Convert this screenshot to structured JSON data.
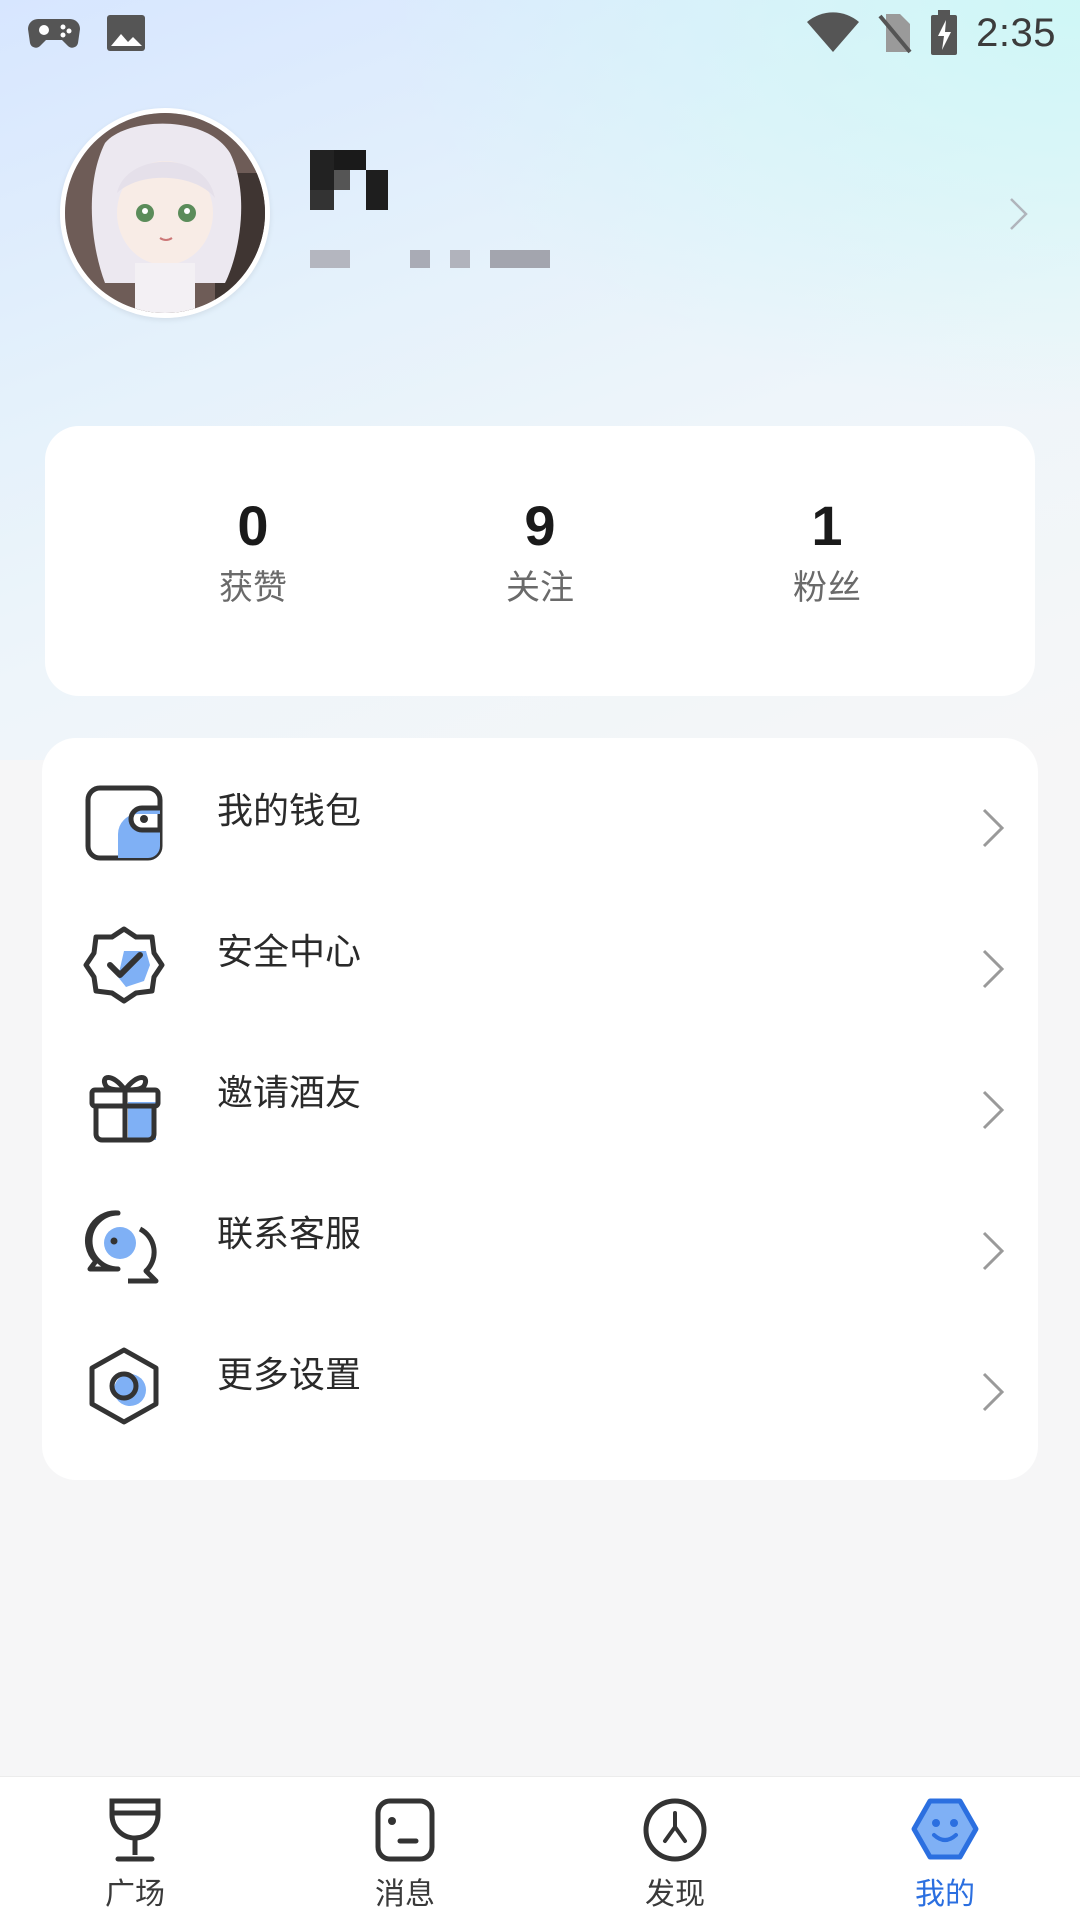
{
  "status_bar": {
    "time": "2:35",
    "left_icons": [
      "gamepad-icon",
      "image-icon"
    ],
    "right_icons": [
      "wifi-icon",
      "no-sim-icon",
      "battery-charging-icon"
    ]
  },
  "profile": {
    "name": "",
    "id_text": "",
    "avatar_icon": "avatar-image"
  },
  "stats": [
    {
      "value": "0",
      "label": "获赞"
    },
    {
      "value": "9",
      "label": "关注"
    },
    {
      "value": "1",
      "label": "粉丝"
    }
  ],
  "menu": [
    {
      "label": "我的钱包",
      "icon": "wallet-icon"
    },
    {
      "label": "安全中心",
      "icon": "security-badge-icon"
    },
    {
      "label": "邀请酒友",
      "icon": "gift-icon"
    },
    {
      "label": "联系客服",
      "icon": "chat-bubbles-icon"
    },
    {
      "label": "更多设置",
      "icon": "settings-hexagon-icon"
    }
  ],
  "nav": [
    {
      "label": "广场",
      "icon": "wine-glass-icon",
      "active": false
    },
    {
      "label": "消息",
      "icon": "message-icon",
      "active": false
    },
    {
      "label": "发现",
      "icon": "compass-icon",
      "active": false
    },
    {
      "label": "我的",
      "icon": "smiley-hexagon-icon",
      "active": true
    }
  ],
  "colors": {
    "accent": "#2b6fe0",
    "icon_fill": "#7fb0f5",
    "icon_stroke": "#333333"
  }
}
